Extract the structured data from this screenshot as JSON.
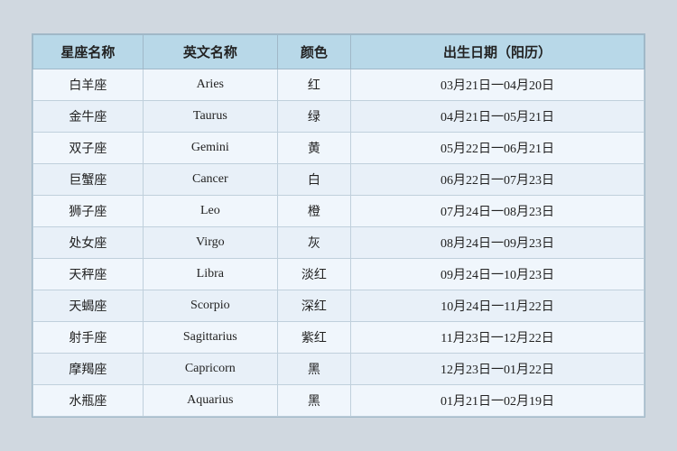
{
  "table": {
    "headers": [
      "星座名称",
      "英文名称",
      "颜色",
      "出生日期（阳历）"
    ],
    "rows": [
      {
        "chinese": "白羊座",
        "english": "Aries",
        "color": "红",
        "date": "03月21日一04月20日"
      },
      {
        "chinese": "金牛座",
        "english": "Taurus",
        "color": "绿",
        "date": "04月21日一05月21日"
      },
      {
        "chinese": "双子座",
        "english": "Gemini",
        "color": "黄",
        "date": "05月22日一06月21日"
      },
      {
        "chinese": "巨蟹座",
        "english": "Cancer",
        "color": "白",
        "date": "06月22日一07月23日"
      },
      {
        "chinese": "狮子座",
        "english": "Leo",
        "color": "橙",
        "date": "07月24日一08月23日"
      },
      {
        "chinese": "处女座",
        "english": "Virgo",
        "color": "灰",
        "date": "08月24日一09月23日"
      },
      {
        "chinese": "天秤座",
        "english": "Libra",
        "color": "淡红",
        "date": "09月24日一10月23日"
      },
      {
        "chinese": "天蝎座",
        "english": "Scorpio",
        "color": "深红",
        "date": "10月24日一11月22日"
      },
      {
        "chinese": "射手座",
        "english": "Sagittarius",
        "color": "紫红",
        "date": "11月23日一12月22日"
      },
      {
        "chinese": "摩羯座",
        "english": "Capricorn",
        "color": "黑",
        "date": "12月23日一01月22日"
      },
      {
        "chinese": "水瓶座",
        "english": "Aquarius",
        "color": "黑",
        "date": "01月21日一02月19日"
      }
    ]
  }
}
